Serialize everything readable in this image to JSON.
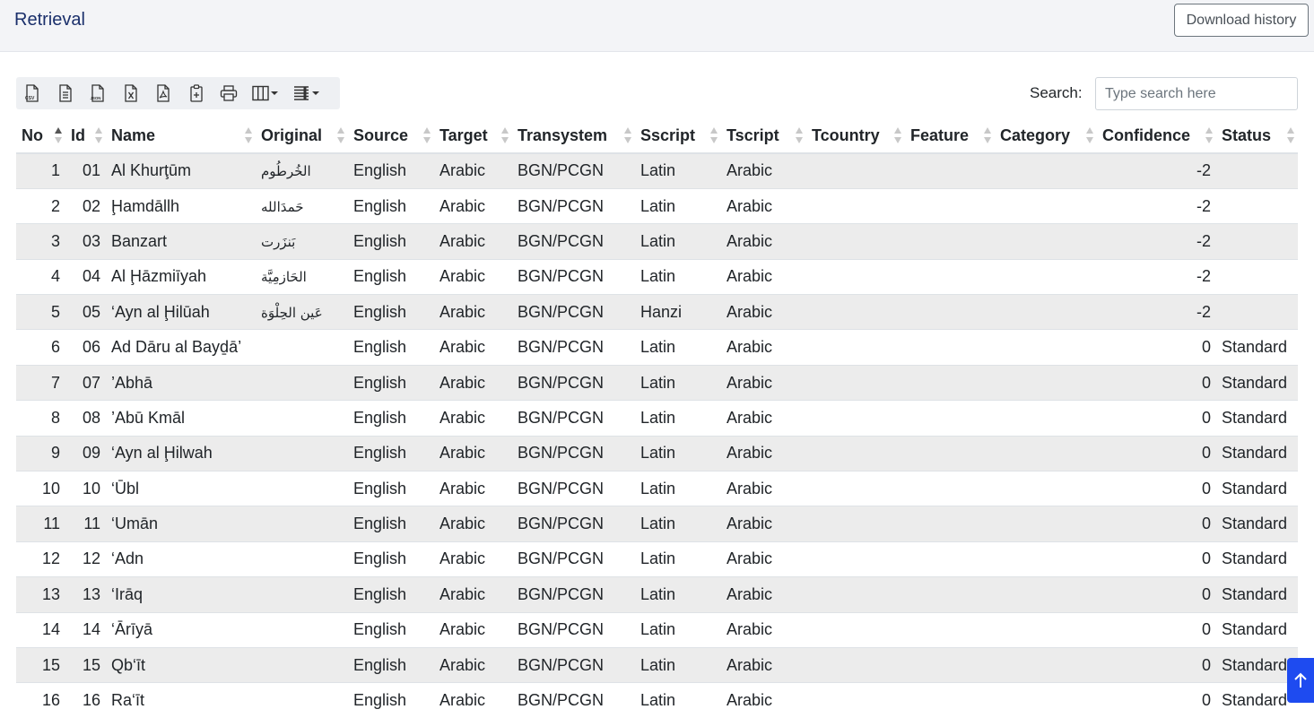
{
  "header": {
    "title": "Retrieval",
    "download_label": "Download history"
  },
  "toolbar": {
    "buttons": [
      {
        "name": "export-csv-button",
        "icon": "csv-file-icon",
        "caption": "CSV"
      },
      {
        "name": "export-text-button",
        "icon": "text-file-icon"
      },
      {
        "name": "export-json-button",
        "icon": "json-file-icon",
        "caption": "JSON"
      },
      {
        "name": "export-excel-button",
        "icon": "excel-file-icon"
      },
      {
        "name": "export-pdf-button",
        "icon": "pdf-file-icon"
      },
      {
        "name": "copy-clipboard-button",
        "icon": "clipboard-icon"
      },
      {
        "name": "print-button",
        "icon": "printer-icon"
      },
      {
        "name": "column-visibility-button",
        "icon": "columns-icon"
      },
      {
        "name": "page-length-button",
        "icon": "list-icon"
      }
    ]
  },
  "search": {
    "label": "Search:",
    "placeholder": "Type search here",
    "value": ""
  },
  "table": {
    "columns": [
      "No",
      "Id",
      "Name",
      "Original",
      "Source",
      "Target",
      "Transystem",
      "Sscript",
      "Tscript",
      "Tcountry",
      "Feature",
      "Category",
      "Confidence",
      "Status"
    ],
    "sorted_column": "No",
    "rows": [
      {
        "no": "1",
        "id": "01",
        "name": "Al Khurţūm",
        "original": "الخُرطُوم",
        "source": "English",
        "target": "Arabic",
        "transystem": "BGN/PCGN",
        "sscript": "Latin",
        "tscript": "Arabic",
        "tcountry": "",
        "feature": "",
        "category": "",
        "confidence": "-2",
        "status": ""
      },
      {
        "no": "2",
        "id": "02",
        "name": "Ḩamdāllh",
        "original": "حَمدَالله",
        "source": "English",
        "target": "Arabic",
        "transystem": "BGN/PCGN",
        "sscript": "Latin",
        "tscript": "Arabic",
        "tcountry": "",
        "feature": "",
        "category": "",
        "confidence": "-2",
        "status": ""
      },
      {
        "no": "3",
        "id": "03",
        "name": "Banzart",
        "original": "بَنزَرت",
        "source": "English",
        "target": "Arabic",
        "transystem": "BGN/PCGN",
        "sscript": "Latin",
        "tscript": "Arabic",
        "tcountry": "",
        "feature": "",
        "category": "",
        "confidence": "-2",
        "status": ""
      },
      {
        "no": "4",
        "id": "04",
        "name": "Al Ḩāzmiīyah",
        "original": "الحَازمِيَّة",
        "source": "English",
        "target": "Arabic",
        "transystem": "BGN/PCGN",
        "sscript": "Latin",
        "tscript": "Arabic",
        "tcountry": "",
        "feature": "",
        "category": "",
        "confidence": "-2",
        "status": ""
      },
      {
        "no": "5",
        "id": "05",
        "name": "‘Ayn al Ḩilūah",
        "original": "عَين الحِلْوَة",
        "source": "English",
        "target": "Arabic",
        "transystem": "BGN/PCGN",
        "sscript": "Hanzi",
        "tscript": "Arabic",
        "tcountry": "",
        "feature": "",
        "category": "",
        "confidence": "-2",
        "status": ""
      },
      {
        "no": "6",
        "id": "06",
        "name": "Ad Dāru al Bayḏā’",
        "original": "",
        "source": "English",
        "target": "Arabic",
        "transystem": "BGN/PCGN",
        "sscript": "Latin",
        "tscript": "Arabic",
        "tcountry": "",
        "feature": "",
        "category": "",
        "confidence": "0",
        "status": "Standard"
      },
      {
        "no": "7",
        "id": "07",
        "name": "’Abhā",
        "original": "",
        "source": "English",
        "target": "Arabic",
        "transystem": "BGN/PCGN",
        "sscript": "Latin",
        "tscript": "Arabic",
        "tcountry": "",
        "feature": "",
        "category": "",
        "confidence": "0",
        "status": "Standard"
      },
      {
        "no": "8",
        "id": "08",
        "name": "’Abū Kmāl",
        "original": "",
        "source": "English",
        "target": "Arabic",
        "transystem": "BGN/PCGN",
        "sscript": "Latin",
        "tscript": "Arabic",
        "tcountry": "",
        "feature": "",
        "category": "",
        "confidence": "0",
        "status": "Standard"
      },
      {
        "no": "9",
        "id": "09",
        "name": "‘Ayn al Ḩilwah",
        "original": "",
        "source": "English",
        "target": "Arabic",
        "transystem": "BGN/PCGN",
        "sscript": "Latin",
        "tscript": "Arabic",
        "tcountry": "",
        "feature": "",
        "category": "",
        "confidence": "0",
        "status": "Standard"
      },
      {
        "no": "10",
        "id": "10",
        "name": "‘Ūbl",
        "original": "",
        "source": "English",
        "target": "Arabic",
        "transystem": "BGN/PCGN",
        "sscript": "Latin",
        "tscript": "Arabic",
        "tcountry": "",
        "feature": "",
        "category": "",
        "confidence": "0",
        "status": "Standard"
      },
      {
        "no": "11",
        "id": "11",
        "name": "‘Umān",
        "original": "",
        "source": "English",
        "target": "Arabic",
        "transystem": "BGN/PCGN",
        "sscript": "Latin",
        "tscript": "Arabic",
        "tcountry": "",
        "feature": "",
        "category": "",
        "confidence": "0",
        "status": "Standard"
      },
      {
        "no": "12",
        "id": "12",
        "name": "‘Adn",
        "original": "",
        "source": "English",
        "target": "Arabic",
        "transystem": "BGN/PCGN",
        "sscript": "Latin",
        "tscript": "Arabic",
        "tcountry": "",
        "feature": "",
        "category": "",
        "confidence": "0",
        "status": "Standard"
      },
      {
        "no": "13",
        "id": "13",
        "name": "‘Irāq",
        "original": "",
        "source": "English",
        "target": "Arabic",
        "transystem": "BGN/PCGN",
        "sscript": "Latin",
        "tscript": "Arabic",
        "tcountry": "",
        "feature": "",
        "category": "",
        "confidence": "0",
        "status": "Standard"
      },
      {
        "no": "14",
        "id": "14",
        "name": "‘Ārīyā",
        "original": "",
        "source": "English",
        "target": "Arabic",
        "transystem": "BGN/PCGN",
        "sscript": "Latin",
        "tscript": "Arabic",
        "tcountry": "",
        "feature": "",
        "category": "",
        "confidence": "0",
        "status": "Standard"
      },
      {
        "no": "15",
        "id": "15",
        "name": "Qb‘īt",
        "original": "",
        "source": "English",
        "target": "Arabic",
        "transystem": "BGN/PCGN",
        "sscript": "Latin",
        "tscript": "Arabic",
        "tcountry": "",
        "feature": "",
        "category": "",
        "confidence": "0",
        "status": "Standard"
      },
      {
        "no": "16",
        "id": "16",
        "name": "Ra‘īt",
        "original": "",
        "source": "English",
        "target": "Arabic",
        "transystem": "BGN/PCGN",
        "sscript": "Latin",
        "tscript": "Arabic",
        "tcountry": "",
        "feature": "",
        "category": "",
        "confidence": "0",
        "status": "Standard"
      }
    ]
  },
  "scroll_top": {
    "icon": "arrow-up-icon"
  },
  "colors": {
    "title": "#1a2f6b",
    "stripe": "#ececec",
    "scroll_button": "#1e4bf0"
  }
}
